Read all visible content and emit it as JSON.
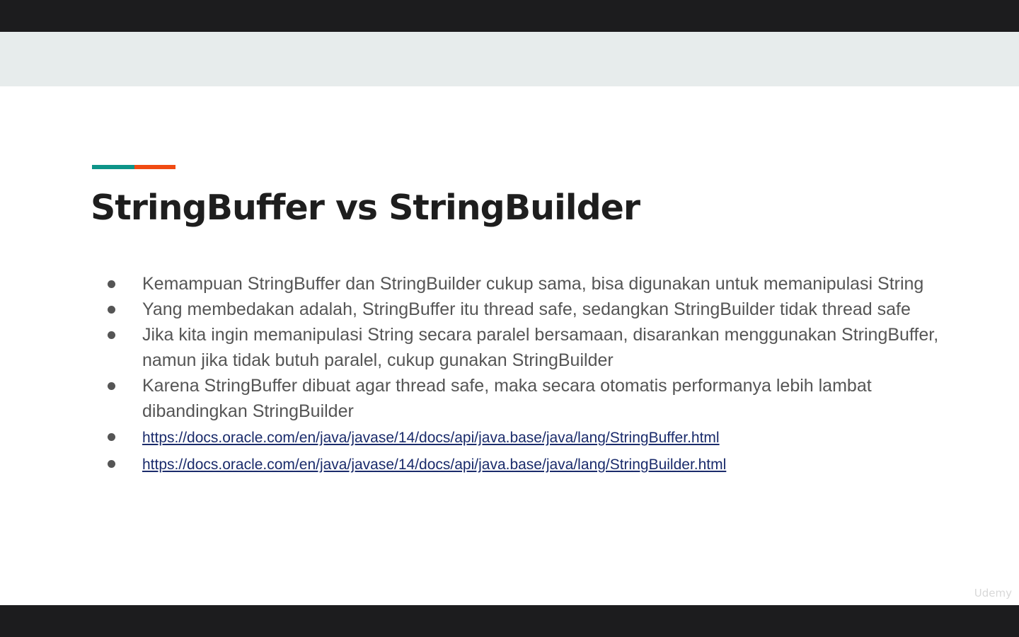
{
  "colors": {
    "letterbox": "#1c1c1e",
    "band": "#e7ecec",
    "accent_teal": "#0d9488",
    "accent_orange": "#f04a12",
    "title": "#1e1e1e",
    "body_text": "#555555",
    "link": "#1a2b6b"
  },
  "slide": {
    "title": "StringBuffer vs StringBuilder",
    "bullets": [
      {
        "text": "Kemampuan StringBuffer dan StringBuilder cukup sama, bisa digunakan untuk memanipulasi String"
      },
      {
        "text": "Yang membedakan adalah, StringBuffer itu thread safe, sedangkan StringBuilder tidak thread safe"
      },
      {
        "text": "Jika kita ingin memanipulasi String secara paralel bersamaan, disarankan menggunakan StringBuffer, namun jika tidak butuh paralel, cukup gunakan StringBuilder"
      },
      {
        "text": "Karena StringBuffer dibuat agar thread safe, maka secara otomatis performanya lebih lambat dibandingkan StringBuilder"
      }
    ],
    "links": [
      {
        "text": "https://docs.oracle.com/en/java/javase/14/docs/api/java.base/java/lang/StringBuffer.html"
      },
      {
        "text": "https://docs.oracle.com/en/java/javase/14/docs/api/java.base/java/lang/StringBuilder.html"
      }
    ],
    "watermark": "Udemy"
  }
}
